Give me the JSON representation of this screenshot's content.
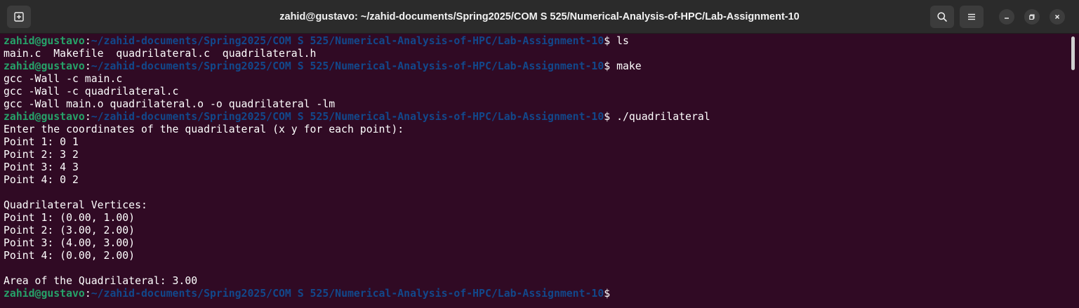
{
  "window": {
    "title": "zahid@gustavo: ~/zahid-documents/Spring2025/COM S 525/Numerical-Analysis-of-HPC/Lab-Assignment-10",
    "icons": {
      "new_tab": "new-tab-icon",
      "search": "search-icon",
      "menu": "hamburger-menu-icon",
      "minimize": "minimize-icon",
      "maximize": "maximize-icon",
      "close": "close-icon"
    }
  },
  "colors": {
    "background": "#300a24",
    "prompt_user": "#26a269",
    "prompt_path": "#12488b",
    "text": "#ffffff",
    "titlebar": "#2b2b2b"
  },
  "prompt": {
    "user": "zahid@gustavo",
    "colon": ":",
    "path": "~/zahid-documents/Spring2025/COM S 525/Numerical-Analysis-of-HPC/Lab-Assignment-10",
    "dollar": "$"
  },
  "lines": [
    {
      "prompt": true,
      "cmd": " ls"
    },
    {
      "text": "main.c  Makefile  quadrilateral.c  quadrilateral.h"
    },
    {
      "prompt": true,
      "cmd": " make"
    },
    {
      "text": "gcc -Wall -c main.c"
    },
    {
      "text": "gcc -Wall -c quadrilateral.c"
    },
    {
      "text": "gcc -Wall main.o quadrilateral.o -o quadrilateral -lm"
    },
    {
      "prompt": true,
      "cmd": " ./quadrilateral"
    },
    {
      "text": "Enter the coordinates of the quadrilateral (x y for each point):"
    },
    {
      "text": "Point 1: 0 1"
    },
    {
      "text": "Point 2: 3 2"
    },
    {
      "text": "Point 3: 4 3"
    },
    {
      "text": "Point 4: 0 2"
    },
    {
      "text": ""
    },
    {
      "text": "Quadrilateral Vertices:"
    },
    {
      "text": "Point 1: (0.00, 1.00)"
    },
    {
      "text": "Point 2: (3.00, 2.00)"
    },
    {
      "text": "Point 3: (4.00, 3.00)"
    },
    {
      "text": "Point 4: (0.00, 2.00)"
    },
    {
      "text": ""
    },
    {
      "text": "Area of the Quadrilateral: 3.00"
    },
    {
      "prompt": true,
      "cmd": ""
    }
  ]
}
